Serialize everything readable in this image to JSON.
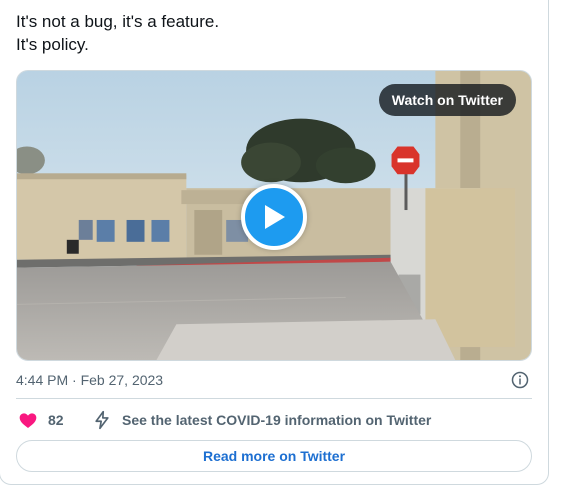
{
  "tweet": {
    "text_lines": [
      "It's not a bug, it's a feature.",
      "It's policy."
    ],
    "timestamp": "4:44 PM · Feb 27, 2023"
  },
  "media": {
    "watch_label": "Watch on Twitter",
    "play_icon": "play-icon"
  },
  "actions": {
    "like_count": "82",
    "like_icon": "heart-icon",
    "covid_icon": "bolt-icon",
    "covid_label": "See the latest COVID-19 information on Twitter",
    "info_icon": "info-icon"
  },
  "footer": {
    "read_more_label": "Read more on Twitter"
  },
  "colors": {
    "accent": "#1d9bf0",
    "like": "#f91880",
    "link": "#1d6fd1",
    "muted": "#536471"
  }
}
